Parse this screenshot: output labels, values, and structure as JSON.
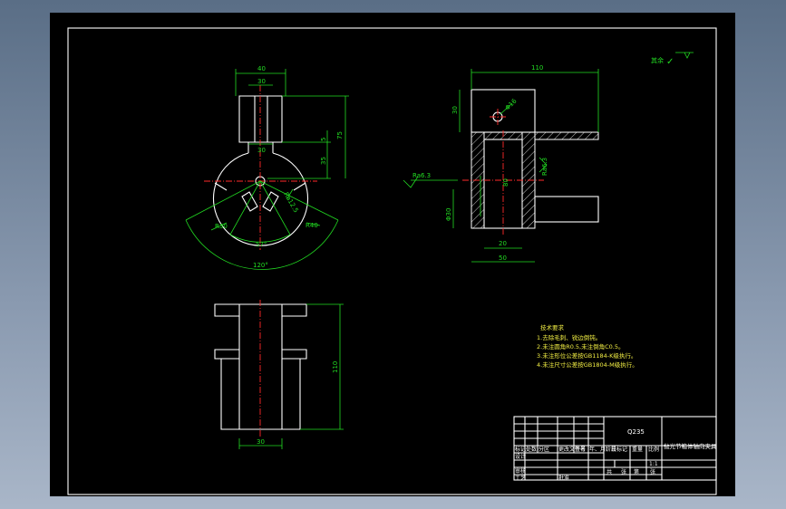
{
  "top_view": {
    "dims": {
      "top_width": "40",
      "slot_width": "30",
      "middle_width": "30",
      "height_total": "75",
      "height_upper": "5",
      "height_mid": "35"
    },
    "angles": {
      "inner": "57°",
      "outer": "120°"
    },
    "radii": {
      "left": "R30",
      "right": "R40"
    },
    "roughness": "Ra12.5"
  },
  "side_view": {
    "dims": {
      "top": "110",
      "left": "30",
      "hole": "Φ16",
      "height": "80",
      "width_inner": "20",
      "width_outer": "50",
      "bottom_left": "Φ30"
    },
    "roughness_left": "Ra6.3",
    "roughness_right": "Ra6.3"
  },
  "bottom_view": {
    "dims": {
      "height": "110",
      "width": "30"
    }
  },
  "corner_mark": {
    "label": "其余",
    "symbol": "✓"
  },
  "notes": {
    "title": "技术要求",
    "items": [
      "1.去除毛刺、锐边倒钝。",
      "2.未注圆角R0.5,未注倒角C0.5。",
      "3.未注形位公差按GB1184-K级执行。",
      "4.未注尺寸公差按GB1804-M级执行。"
    ]
  },
  "title_block": {
    "material": "Q235",
    "part_name": "抛光节箱体轴向夹具",
    "row_labels": [
      "标记",
      "处数",
      "分区",
      "更改文件号",
      "签名",
      "年、月、日"
    ],
    "labels2": [
      "设计",
      "审核",
      "工艺",
      "批准"
    ],
    "stage_labels": [
      "阶段标记",
      "重量",
      "比例"
    ],
    "scale": "1:1",
    "sheet_labels": [
      "共",
      "张",
      "第",
      "张"
    ]
  }
}
